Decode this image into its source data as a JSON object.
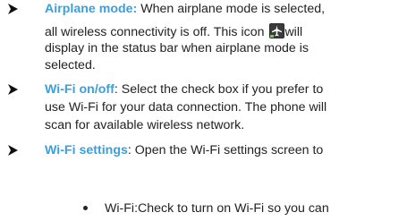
{
  "items": [
    {
      "term": "Airplane mode:",
      "line1_rest": " When airplane mode is selected,",
      "line2_before_icon": "all wireless connectivity is off. This icon ",
      "line2_after_icon": "will",
      "line3": "display in the status bar when airplane mode is",
      "line4": "selected."
    },
    {
      "term": "Wi-Fi on/off",
      "line1_rest": ": Select the check box if you prefer to",
      "line2": "use Wi-Fi for your data connection. The phone will",
      "line3": "scan for available wireless network."
    },
    {
      "term": "Wi-Fi settings",
      "line1_rest": ": Open the Wi-Fi settings screen to"
    }
  ],
  "sub_bullets": [
    {
      "text": "Wi-Fi:Check to turn on Wi-Fi so you can"
    }
  ],
  "icons": {
    "bullet_arrow": "arrow-bullet-icon",
    "airplane": "airplane-mode-icon"
  },
  "colors": {
    "term": "#3aa0dd",
    "text": "#222222"
  }
}
